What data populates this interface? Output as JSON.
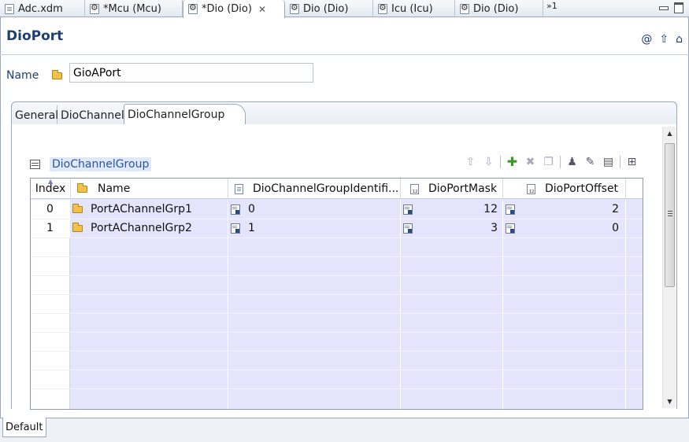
{
  "editor_tabs": [
    {
      "label": "Adc.xdm",
      "icon": "document-icon",
      "active": false,
      "closable": false
    },
    {
      "label": "*Mcu (Mcu)",
      "icon": "config-icon",
      "active": false,
      "closable": false
    },
    {
      "label": "*Dio (Dio)",
      "icon": "config-icon",
      "active": true,
      "closable": true
    },
    {
      "label": "Dio (Dio)",
      "icon": "config-icon",
      "active": false,
      "closable": false
    },
    {
      "label": "Icu (Icu)",
      "icon": "config-icon",
      "active": false,
      "closable": false
    },
    {
      "label": "Dio (Dio)",
      "icon": "config-icon",
      "active": false,
      "closable": false
    }
  ],
  "tab_overflow": "»1",
  "page": {
    "title": "DioPort",
    "header_icons": [
      "at-icon",
      "arrow-up-icon",
      "home-icon"
    ]
  },
  "name_field": {
    "label": "Name",
    "value": "GioAPort"
  },
  "sub_tabs": [
    {
      "label": "General",
      "active": false
    },
    {
      "label": "DioChannel",
      "active": false
    },
    {
      "label": "DioChannelGroup",
      "active": true
    }
  ],
  "section": {
    "title": "DioChannelGroup"
  },
  "toolbar_icons": [
    "move-up-icon",
    "move-down-icon",
    "add-icon",
    "delete-icon",
    "copy-icon",
    "user-icon",
    "edit-icon",
    "properties-icon",
    "import-icon"
  ],
  "table": {
    "headers": [
      "Index",
      "Name",
      "DioChannelGroupIdentifi...",
      "DioPortMask",
      "DioPortOffset"
    ],
    "rows": [
      {
        "index": "0",
        "name": "PortAChannelGrp1",
        "identifier": "0",
        "mask": "12",
        "offset": "2"
      },
      {
        "index": "1",
        "name": "PortAChannelGrp2",
        "identifier": "1",
        "mask": "3",
        "offset": "0"
      }
    ]
  },
  "bottom_tabs": [
    "Default"
  ],
  "colors": {
    "title": "#1f3f73",
    "table_fill": "#e4e4fc",
    "section_title": "#2a55a8"
  }
}
